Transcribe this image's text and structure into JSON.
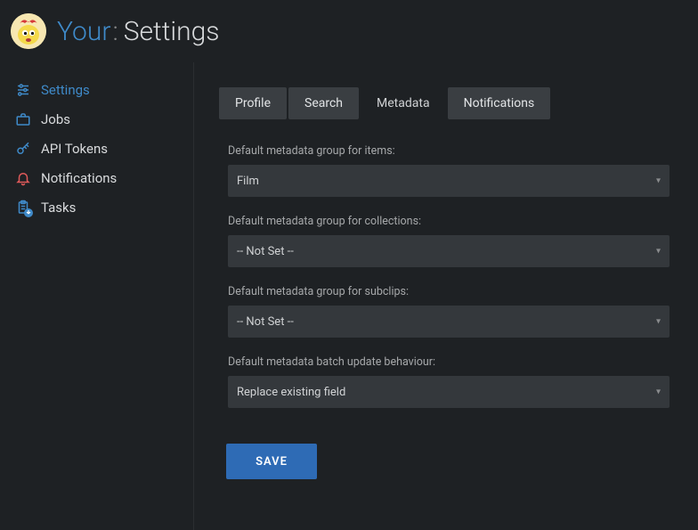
{
  "header": {
    "brand": "Your",
    "colon": ":",
    "page": "Settings"
  },
  "sidebar": {
    "items": [
      {
        "label": "Settings",
        "icon": "sliders-icon",
        "active": true
      },
      {
        "label": "Jobs",
        "icon": "briefcase-icon"
      },
      {
        "label": "API Tokens",
        "icon": "key-icon"
      },
      {
        "label": "Notifications",
        "icon": "bell-icon",
        "notif": true
      },
      {
        "label": "Tasks",
        "icon": "clipboard-icon",
        "badge": true
      }
    ]
  },
  "tabs": [
    {
      "label": "Profile"
    },
    {
      "label": "Search"
    },
    {
      "label": "Metadata",
      "active": true
    },
    {
      "label": "Notifications"
    }
  ],
  "form": {
    "fields": [
      {
        "label": "Default metadata group for items:",
        "value": "Film"
      },
      {
        "label": "Default metadata group for collections:",
        "value": "-- Not Set --"
      },
      {
        "label": "Default metadata group for subclips:",
        "value": "-- Not Set --"
      },
      {
        "label": "Default metadata batch update behaviour:",
        "value": "Replace existing field"
      }
    ],
    "save_label": "SAVE"
  }
}
